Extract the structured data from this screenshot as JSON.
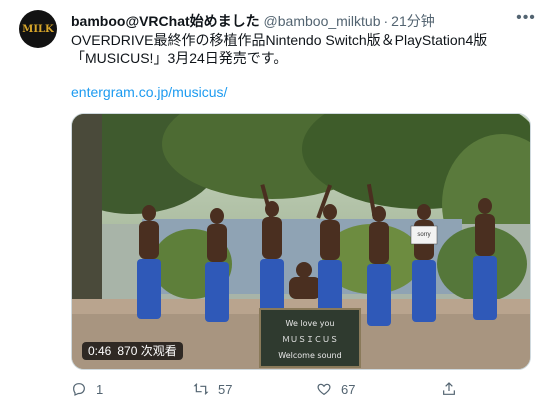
{
  "tweet": {
    "author": {
      "display_name": "bamboo@VRChat始めました",
      "handle": "@bamboo_milktub",
      "time": "21分钟",
      "avatar_text": "MILK"
    },
    "text_lines": [
      "OVERDRIVE最終作の移植作品Nintendo Switch版＆PlayStation4版",
      "「MUSICUS!」3月24日発売です。"
    ],
    "link": "entergram.co.jp/musicus/",
    "video": {
      "duration": "0:46",
      "views": "870 次观看",
      "sign_lines": [
        "We love you",
        "ＭＵＳＩＣＵＳ",
        "Welcome sound"
      ],
      "held_sign_text": "sorry"
    },
    "actions": {
      "replies": "1",
      "retweets": "57",
      "likes": "67"
    }
  },
  "colors": {
    "link": "#1d9bf0",
    "secondary_text": "#536471",
    "primary_text": "#0f1419",
    "badge_bg": "#000000"
  },
  "icons": [
    "more-icon",
    "reply-icon",
    "retweet-icon",
    "like-icon",
    "share-icon"
  ]
}
